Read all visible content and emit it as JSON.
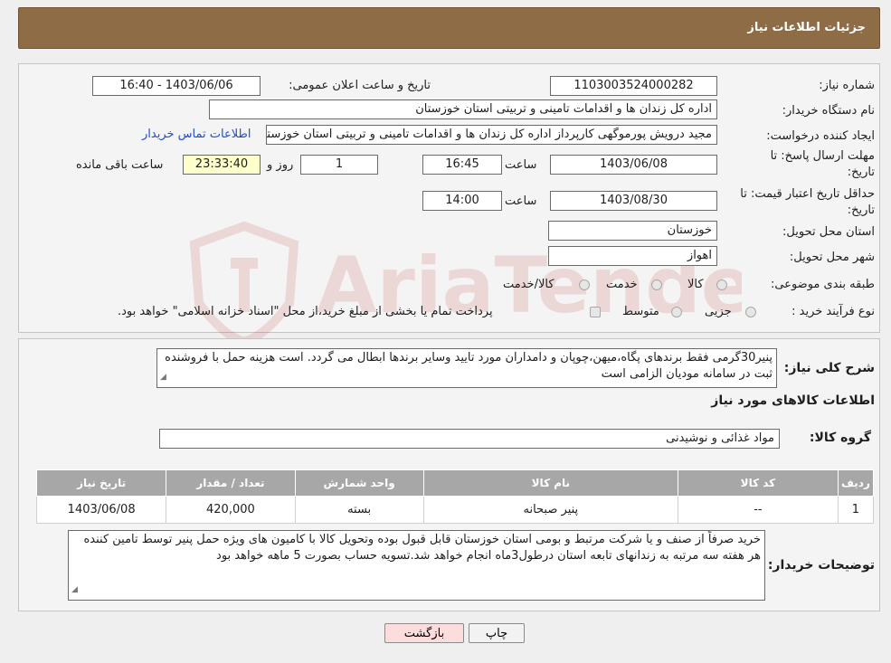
{
  "header": {
    "title": "جزئیات اطلاعات نیاز"
  },
  "watermark": {
    "text": "AriaTender.neT"
  },
  "form": {
    "need_number": {
      "label": "شماره نیاز:",
      "value": "1103003524000282"
    },
    "announce": {
      "label": "تاریخ و ساعت اعلان عمومی:",
      "value": "1403/06/06 - 16:40"
    },
    "buyer": {
      "label": "نام دستگاه خریدار:",
      "value": "اداره کل زندان ها و اقدامات تامینی و تربیتی استان خوزستان"
    },
    "creator": {
      "label": "ایجاد کننده درخواست:",
      "value": "مجید درویش پورموگهی کارپرداز اداره کل زندان ها و اقدامات تامینی و تربیتی استان خوزستان",
      "contact_link": "اطلاعات تماس خریدار"
    },
    "deadline": {
      "label_line1": "مهلت ارسال پاسخ: تا",
      "label_line2": "تاریخ:",
      "date": "1403/06/08",
      "time_label": "ساعت",
      "time": "16:45",
      "days": "1",
      "days_label": "روز و",
      "remaining": "23:33:40",
      "remaining_label": "ساعت باقی مانده"
    },
    "validity": {
      "label_line1": "حداقل تاریخ اعتبار قیمت: تا",
      "label_line2": "تاریخ:",
      "date": "1403/08/30",
      "time_label": "ساعت",
      "time": "14:00"
    },
    "province": {
      "label": "استان محل تحویل:",
      "value": "خوزستان"
    },
    "city": {
      "label": "شهر محل تحویل:",
      "value": "اهواز"
    },
    "category": {
      "label": "طبقه بندی موضوعی:",
      "options": [
        "کالا",
        "خدمت",
        "کالا/خدمت"
      ]
    },
    "process": {
      "label": "نوع فرآیند خرید :",
      "options": [
        "جزیی",
        "متوسط"
      ],
      "note": "پرداخت تمام یا بخشی از مبلغ خرید،از محل \"اسناد خزانه اسلامی\" خواهد بود."
    }
  },
  "details": {
    "description_label": "شرح کلی نیاز:",
    "description": "پنیر30گرمی فقط برندهای پگاه،میهن،چوپان و دامداران مورد تایید وسایر برندها ابطال می گردد. است هزینه حمل با فروشنده ثبت در سامانه مودیان الزامی است",
    "goods_title": "اطلاعات کالاهای مورد نیاز",
    "group_label": "گروه کالا:",
    "group_value": "مواد غذائی و نوشیدنی",
    "table": {
      "headers": [
        "ردیف",
        "کد کالا",
        "نام کالا",
        "واحد شمارش",
        "تعداد / مقدار",
        "تاریخ نیاز"
      ],
      "rows": [
        [
          "1",
          "--",
          "پنیر صبحانه",
          "بسته",
          "420,000",
          "1403/06/08"
        ]
      ]
    },
    "buyer_notes_label": "توضیحات خریدار:",
    "buyer_notes": "خرید صرفاً از صنف و یا شرکت مرتبط  و بومی استان خوزستان قابل قبول بوده وتحویل کالا با کامیون های ویژه حمل پنیر توسط تامین کننده هر هفته سه مرتبه به زندانهای تابعه استان درطول3ماه انجام خواهد شد.تسویه حساب بصورت 5 ماهه خواهد بود"
  },
  "buttons": {
    "print": "چاپ",
    "back": "بازگشت"
  },
  "colors": {
    "header": "#8e6c45",
    "table_header": "#a7a7a7",
    "timer_bg": "#ffffcc",
    "back_button_bg": "#fcdcdc",
    "link": "#1f4fd0"
  }
}
